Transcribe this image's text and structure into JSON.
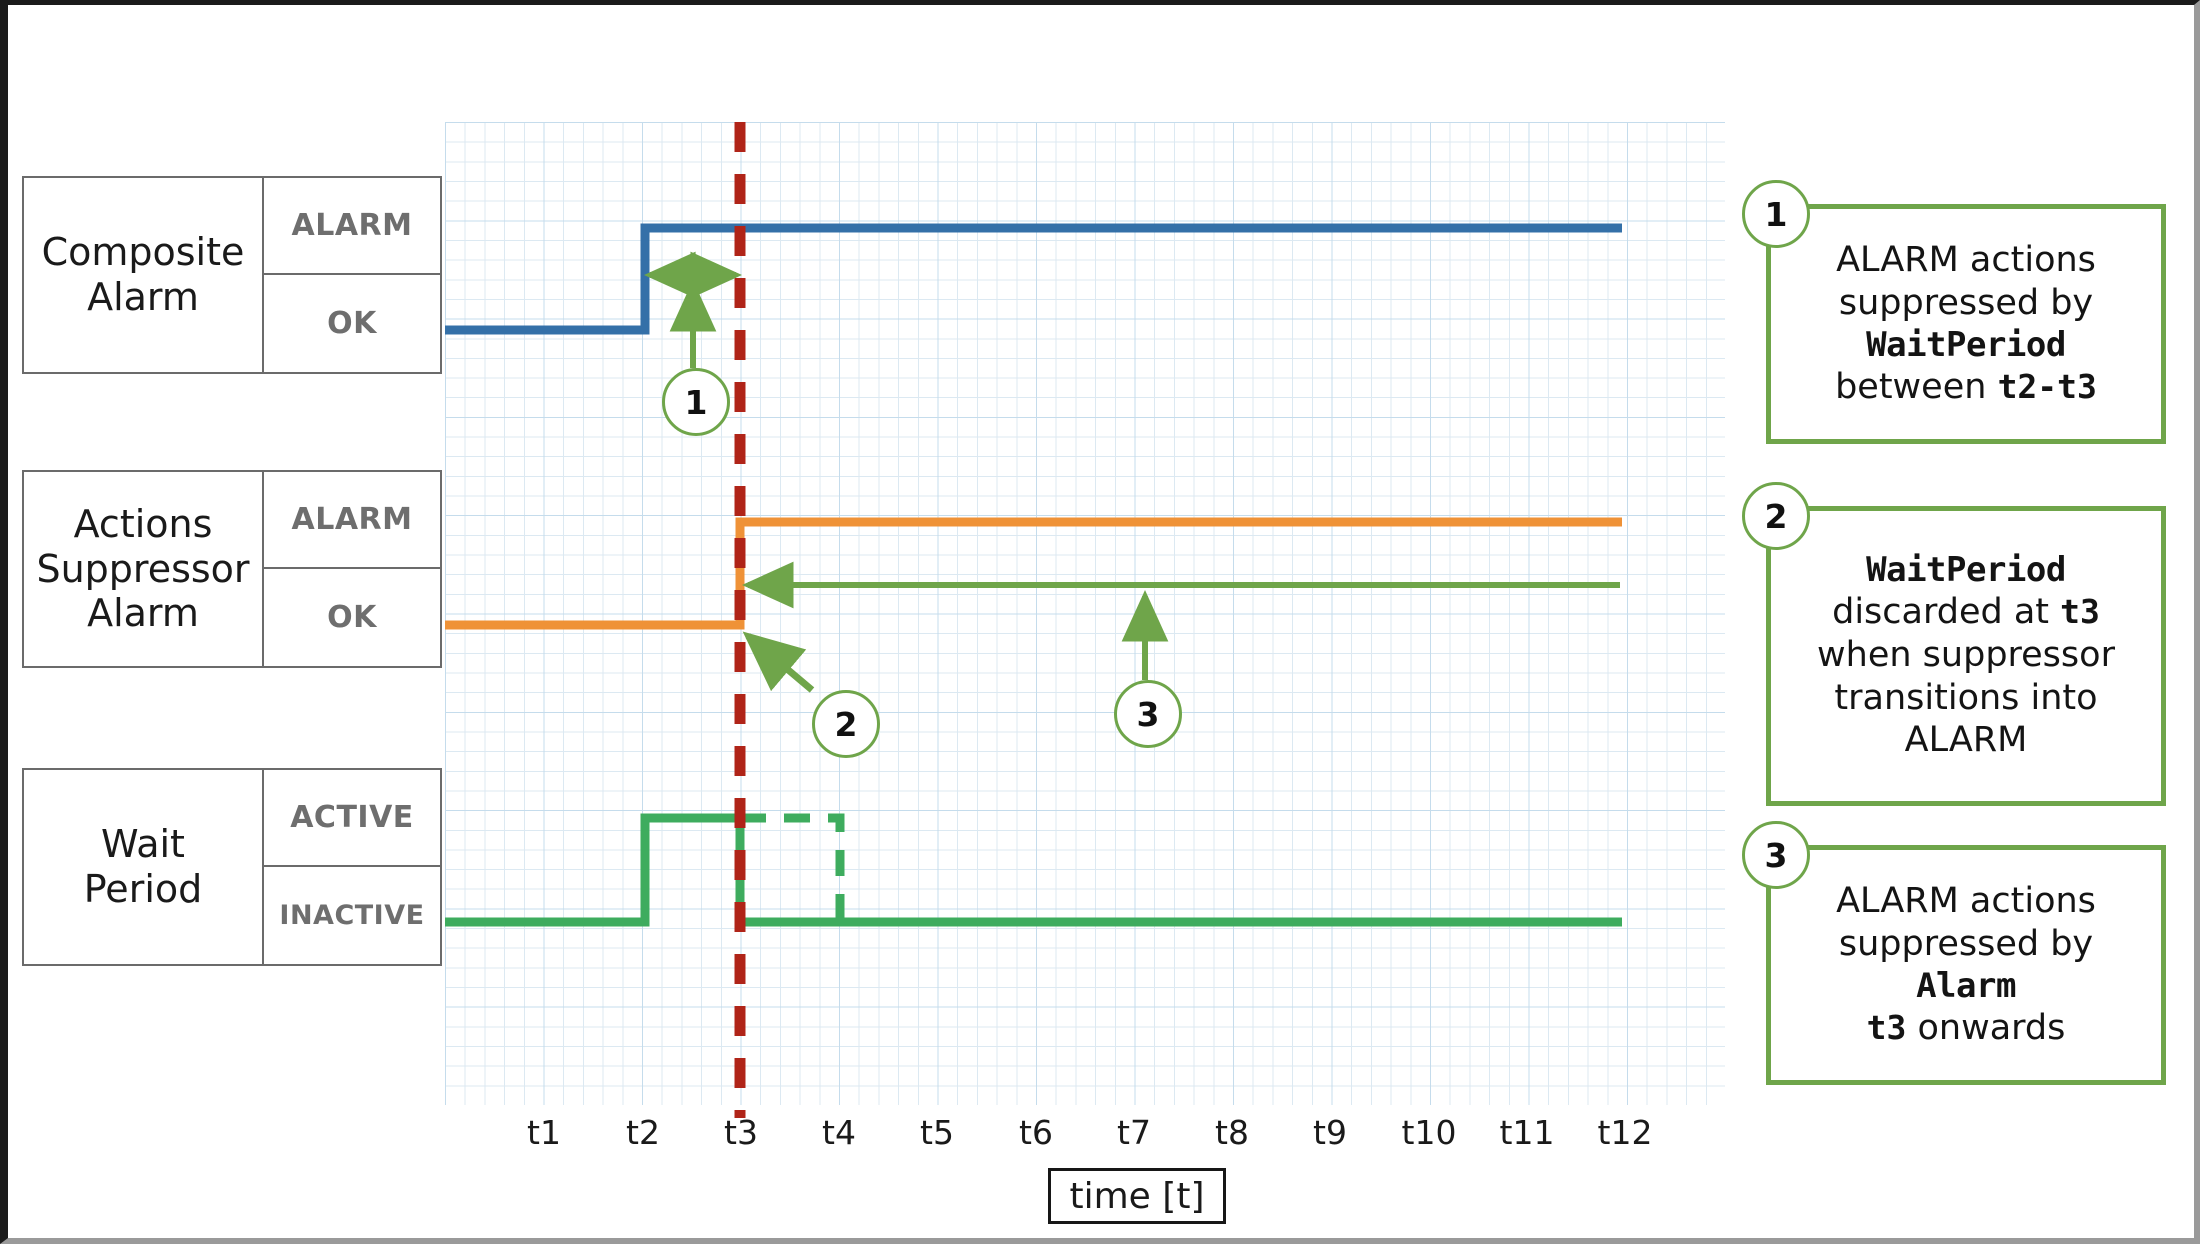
{
  "diagram": {
    "title_axis": "time [t]",
    "colors": {
      "composite_alarm": "#3470a8",
      "suppressor_alarm": "#ef9237",
      "wait_period": "#3eac5e",
      "marker_line": "#b02418",
      "annotation": "#6fa54a",
      "grid_minor": "#dce9f2",
      "grid_major": "#c5dcec",
      "table_border": "#6b6b6b",
      "state_text": "#6e6e6e"
    }
  },
  "signals": [
    {
      "name": "Composite\nAlarm",
      "name_lines": [
        "Composite",
        "Alarm"
      ],
      "states": {
        "high": "ALARM",
        "low": "OK"
      }
    },
    {
      "name": "Actions\nSuppressor\nAlarm",
      "name_lines": [
        "Actions",
        "Suppressor",
        "Alarm"
      ],
      "states": {
        "high": "ALARM",
        "low": "OK"
      }
    },
    {
      "name": "Wait\nPeriod",
      "name_lines": [
        "Wait",
        "Period"
      ],
      "states": {
        "high": "ACTIVE",
        "low": "INACTIVE"
      }
    }
  ],
  "axis": {
    "label": "time [t]",
    "ticks": [
      "t1",
      "t2",
      "t3",
      "t4",
      "t5",
      "t6",
      "t7",
      "t8",
      "t9",
      "t10",
      "t11",
      "t12"
    ]
  },
  "markers": [
    {
      "id": "1",
      "label": "1"
    },
    {
      "id": "2",
      "label": "2"
    },
    {
      "id": "3",
      "label": "3"
    }
  ],
  "callouts": [
    {
      "badge": "1",
      "lines": [
        {
          "text": "ALARM actions",
          "style": "normal"
        },
        {
          "text": "suppressed by",
          "style": "normal"
        },
        {
          "text": "WaitPeriod",
          "style": "mono"
        },
        {
          "text": "between t2-t3",
          "style": "mixed",
          "prefix": "between ",
          "mono": "t2-t3"
        }
      ]
    },
    {
      "badge": "2",
      "lines": [
        {
          "text": "WaitPeriod",
          "style": "mono"
        },
        {
          "text": "discarded at t3",
          "style": "mixed",
          "prefix": "discarded at ",
          "mono": "t3"
        },
        {
          "text": "when suppressor",
          "style": "normal"
        },
        {
          "text": "transitions into",
          "style": "normal"
        },
        {
          "text": "ALARM",
          "style": "normal"
        }
      ]
    },
    {
      "badge": "3",
      "lines": [
        {
          "text": "ALARM actions",
          "style": "normal"
        },
        {
          "text": "suppressed by",
          "style": "normal"
        },
        {
          "text": "Alarm",
          "style": "mono"
        },
        {
          "text": "t3 onwards",
          "style": "mixed",
          "prefix": "",
          "mono": "t3",
          "suffix": " onwards"
        }
      ]
    }
  ],
  "chart_data": {
    "type": "line",
    "title": "",
    "xlabel": "time [t]",
    "ylabel": "",
    "x": [
      "t1",
      "t2",
      "t3",
      "t4",
      "t5",
      "t6",
      "t7",
      "t8",
      "t9",
      "t10",
      "t11",
      "t12"
    ],
    "grid": true,
    "legend": "none",
    "series": [
      {
        "name": "Composite Alarm",
        "color": "#3470a8",
        "states": [
          "OK",
          "ALARM"
        ],
        "transitions": [
          {
            "at": "t2",
            "to": "ALARM"
          }
        ],
        "values": [
          "OK",
          "ALARM",
          "ALARM",
          "ALARM",
          "ALARM",
          "ALARM",
          "ALARM",
          "ALARM",
          "ALARM",
          "ALARM",
          "ALARM",
          "ALARM"
        ]
      },
      {
        "name": "Actions Suppressor Alarm",
        "color": "#ef9237",
        "states": [
          "OK",
          "ALARM"
        ],
        "transitions": [
          {
            "at": "t3",
            "to": "ALARM"
          }
        ],
        "values": [
          "OK",
          "OK",
          "ALARM",
          "ALARM",
          "ALARM",
          "ALARM",
          "ALARM",
          "ALARM",
          "ALARM",
          "ALARM",
          "ALARM",
          "ALARM"
        ]
      },
      {
        "name": "Wait Period",
        "color": "#3eac5e",
        "states": [
          "INACTIVE",
          "ACTIVE"
        ],
        "transitions": [
          {
            "at": "t2",
            "to": "ACTIVE"
          },
          {
            "at": "t3",
            "to": "INACTIVE"
          }
        ],
        "values": [
          "INACTIVE",
          "ACTIVE",
          "INACTIVE",
          "INACTIVE",
          "INACTIVE",
          "INACTIVE",
          "INACTIVE",
          "INACTIVE",
          "INACTIVE",
          "INACTIVE",
          "INACTIVE",
          "INACTIVE"
        ],
        "dashed_continuation": {
          "from": "t3",
          "to": "t4",
          "level": "ACTIVE"
        }
      }
    ],
    "reference_line": {
      "at": "t3",
      "style": "dashed",
      "color": "#b02418"
    },
    "annotations": [
      {
        "id": "1",
        "type": "span-arrow",
        "from": "t2",
        "to": "t3",
        "note": "WaitPeriod suppression window"
      },
      {
        "id": "2",
        "type": "pointer-arrow",
        "at": "t3",
        "note": "WaitPeriod discarded"
      },
      {
        "id": "3",
        "type": "span-arrow",
        "from": "t3",
        "to": "t12",
        "note": "Alarm suppression from t3 onwards"
      }
    ]
  }
}
